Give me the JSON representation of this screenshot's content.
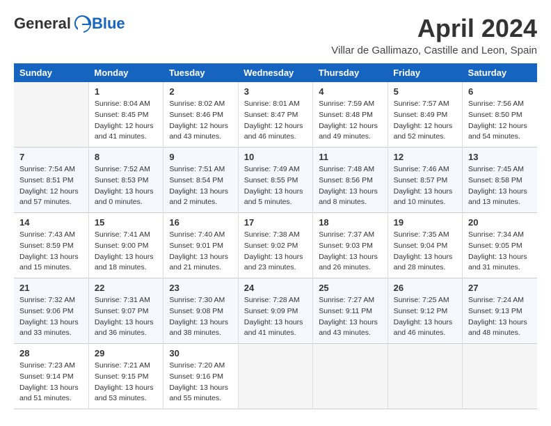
{
  "header": {
    "logo_general": "General",
    "logo_blue": "Blue",
    "month_title": "April 2024",
    "location": "Villar de Gallimazo, Castille and Leon, Spain"
  },
  "columns": [
    "Sunday",
    "Monday",
    "Tuesday",
    "Wednesday",
    "Thursday",
    "Friday",
    "Saturday"
  ],
  "weeks": [
    {
      "days": [
        {
          "num": "",
          "info": ""
        },
        {
          "num": "1",
          "info": "Sunrise: 8:04 AM\nSunset: 8:45 PM\nDaylight: 12 hours\nand 41 minutes."
        },
        {
          "num": "2",
          "info": "Sunrise: 8:02 AM\nSunset: 8:46 PM\nDaylight: 12 hours\nand 43 minutes."
        },
        {
          "num": "3",
          "info": "Sunrise: 8:01 AM\nSunset: 8:47 PM\nDaylight: 12 hours\nand 46 minutes."
        },
        {
          "num": "4",
          "info": "Sunrise: 7:59 AM\nSunset: 8:48 PM\nDaylight: 12 hours\nand 49 minutes."
        },
        {
          "num": "5",
          "info": "Sunrise: 7:57 AM\nSunset: 8:49 PM\nDaylight: 12 hours\nand 52 minutes."
        },
        {
          "num": "6",
          "info": "Sunrise: 7:56 AM\nSunset: 8:50 PM\nDaylight: 12 hours\nand 54 minutes."
        }
      ]
    },
    {
      "days": [
        {
          "num": "7",
          "info": "Sunrise: 7:54 AM\nSunset: 8:51 PM\nDaylight: 12 hours\nand 57 minutes."
        },
        {
          "num": "8",
          "info": "Sunrise: 7:52 AM\nSunset: 8:53 PM\nDaylight: 13 hours\nand 0 minutes."
        },
        {
          "num": "9",
          "info": "Sunrise: 7:51 AM\nSunset: 8:54 PM\nDaylight: 13 hours\nand 2 minutes."
        },
        {
          "num": "10",
          "info": "Sunrise: 7:49 AM\nSunset: 8:55 PM\nDaylight: 13 hours\nand 5 minutes."
        },
        {
          "num": "11",
          "info": "Sunrise: 7:48 AM\nSunset: 8:56 PM\nDaylight: 13 hours\nand 8 minutes."
        },
        {
          "num": "12",
          "info": "Sunrise: 7:46 AM\nSunset: 8:57 PM\nDaylight: 13 hours\nand 10 minutes."
        },
        {
          "num": "13",
          "info": "Sunrise: 7:45 AM\nSunset: 8:58 PM\nDaylight: 13 hours\nand 13 minutes."
        }
      ]
    },
    {
      "days": [
        {
          "num": "14",
          "info": "Sunrise: 7:43 AM\nSunset: 8:59 PM\nDaylight: 13 hours\nand 15 minutes."
        },
        {
          "num": "15",
          "info": "Sunrise: 7:41 AM\nSunset: 9:00 PM\nDaylight: 13 hours\nand 18 minutes."
        },
        {
          "num": "16",
          "info": "Sunrise: 7:40 AM\nSunset: 9:01 PM\nDaylight: 13 hours\nand 21 minutes."
        },
        {
          "num": "17",
          "info": "Sunrise: 7:38 AM\nSunset: 9:02 PM\nDaylight: 13 hours\nand 23 minutes."
        },
        {
          "num": "18",
          "info": "Sunrise: 7:37 AM\nSunset: 9:03 PM\nDaylight: 13 hours\nand 26 minutes."
        },
        {
          "num": "19",
          "info": "Sunrise: 7:35 AM\nSunset: 9:04 PM\nDaylight: 13 hours\nand 28 minutes."
        },
        {
          "num": "20",
          "info": "Sunrise: 7:34 AM\nSunset: 9:05 PM\nDaylight: 13 hours\nand 31 minutes."
        }
      ]
    },
    {
      "days": [
        {
          "num": "21",
          "info": "Sunrise: 7:32 AM\nSunset: 9:06 PM\nDaylight: 13 hours\nand 33 minutes."
        },
        {
          "num": "22",
          "info": "Sunrise: 7:31 AM\nSunset: 9:07 PM\nDaylight: 13 hours\nand 36 minutes."
        },
        {
          "num": "23",
          "info": "Sunrise: 7:30 AM\nSunset: 9:08 PM\nDaylight: 13 hours\nand 38 minutes."
        },
        {
          "num": "24",
          "info": "Sunrise: 7:28 AM\nSunset: 9:09 PM\nDaylight: 13 hours\nand 41 minutes."
        },
        {
          "num": "25",
          "info": "Sunrise: 7:27 AM\nSunset: 9:11 PM\nDaylight: 13 hours\nand 43 minutes."
        },
        {
          "num": "26",
          "info": "Sunrise: 7:25 AM\nSunset: 9:12 PM\nDaylight: 13 hours\nand 46 minutes."
        },
        {
          "num": "27",
          "info": "Sunrise: 7:24 AM\nSunset: 9:13 PM\nDaylight: 13 hours\nand 48 minutes."
        }
      ]
    },
    {
      "days": [
        {
          "num": "28",
          "info": "Sunrise: 7:23 AM\nSunset: 9:14 PM\nDaylight: 13 hours\nand 51 minutes."
        },
        {
          "num": "29",
          "info": "Sunrise: 7:21 AM\nSunset: 9:15 PM\nDaylight: 13 hours\nand 53 minutes."
        },
        {
          "num": "30",
          "info": "Sunrise: 7:20 AM\nSunset: 9:16 PM\nDaylight: 13 hours\nand 55 minutes."
        },
        {
          "num": "",
          "info": ""
        },
        {
          "num": "",
          "info": ""
        },
        {
          "num": "",
          "info": ""
        },
        {
          "num": "",
          "info": ""
        }
      ]
    }
  ]
}
